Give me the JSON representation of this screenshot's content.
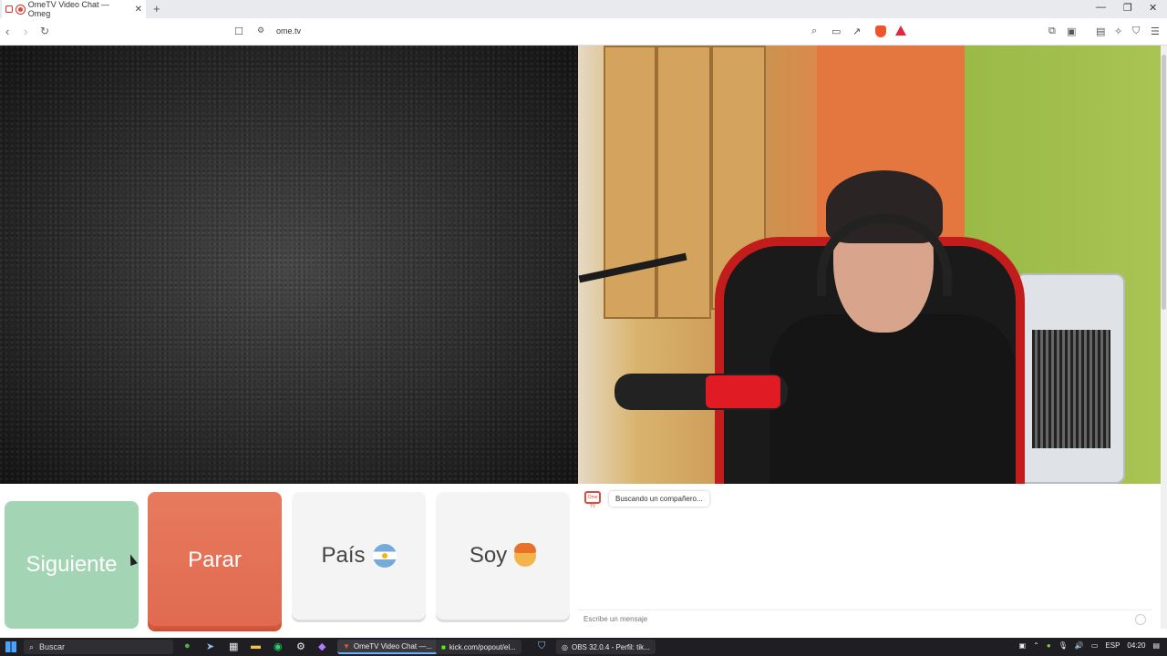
{
  "browser": {
    "tab_title": "OmeTV Video Chat — Omeg",
    "url": "ome.tv"
  },
  "controls": {
    "next_label": "Siguiente",
    "stop_label": "Parar",
    "country_label": "País",
    "gender_label": "Soy"
  },
  "chat": {
    "logo_text": "Ome TV",
    "status_message": "Buscando un compañero...",
    "input_placeholder": "Escribe un mensaje"
  },
  "taskbar": {
    "search_label": "Buscar",
    "tasks": [
      {
        "label": "OmeTV Video Chat —..."
      },
      {
        "label": "kick.com/popout/el..."
      },
      {
        "label": "OBS 32.0.4 - Perfil: tik..."
      }
    ],
    "language": "ESP",
    "time": "04:20"
  },
  "colors": {
    "next_button": "#a3d5b5",
    "stop_button": "#e06a50",
    "brand_red": "#e04a3a"
  },
  "icons": {
    "country_flag": "argentina-flag-icon",
    "gender": "boy-emoji-icon"
  }
}
